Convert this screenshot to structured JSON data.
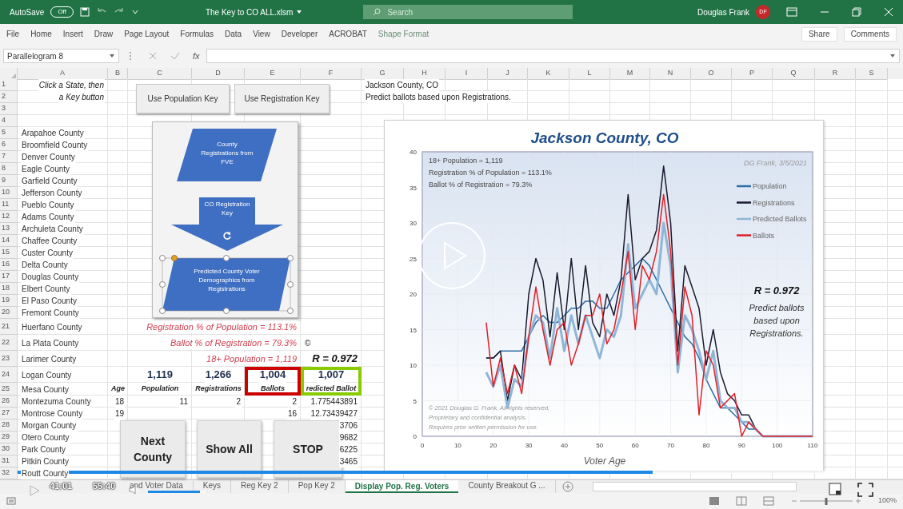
{
  "title_bar": {
    "autosave_label": "AutoSave",
    "autosave_toggle": {
      "text": "Off",
      "on": false
    },
    "file_title": "The Key to CO ALL.xlsm",
    "search_placeholder": "Search",
    "user_name": "Douglas Frank",
    "avatar_initials": "DF"
  },
  "ribbon_tabs": [
    {
      "label": "File",
      "selected": false,
      "kind": "standard"
    },
    {
      "label": "Home",
      "selected": false,
      "kind": "standard"
    },
    {
      "label": "Insert",
      "selected": false,
      "kind": "standard"
    },
    {
      "label": "Draw",
      "selected": false,
      "kind": "standard"
    },
    {
      "label": "Page Layout",
      "selected": false,
      "kind": "standard"
    },
    {
      "label": "Formulas",
      "selected": false,
      "kind": "standard"
    },
    {
      "label": "Data",
      "selected": false,
      "kind": "standard"
    },
    {
      "label": "View",
      "selected": false,
      "kind": "standard"
    },
    {
      "label": "Developer",
      "selected": false,
      "kind": "standard"
    },
    {
      "label": "ACROBAT",
      "selected": false,
      "kind": "standard"
    },
    {
      "label": "Shape Format",
      "selected": false,
      "kind": "contextual"
    }
  ],
  "ribbon_actions": [
    "Share",
    "Comments"
  ],
  "formula_bar": {
    "name_box": "Parallelogram 8",
    "fx": "fx"
  },
  "columns": [
    "A",
    "B",
    "C",
    "D",
    "E",
    "F",
    "G",
    "H",
    "I",
    "J",
    "K",
    "L",
    "M",
    "N",
    "O",
    "P",
    "Q",
    "R",
    "S"
  ],
  "rows": [
    {
      "number": "1",
      "cells": {
        "A": {
          "kind": "note",
          "text": "Click a State, then"
        },
        "G": {
          "kind": "plain",
          "text": "Jackson County, CO"
        }
      }
    },
    {
      "number": "2",
      "cells": {
        "A": {
          "kind": "note",
          "text": "a Key button"
        },
        "G": {
          "kind": "plain",
          "text": "Predict ballots based upon Registrations."
        }
      }
    },
    {
      "number": "3"
    },
    {
      "number": "4"
    },
    {
      "number": "5",
      "cells": {
        "A": {
          "kind": "county",
          "text": "Arapahoe County"
        }
      }
    },
    {
      "number": "6",
      "cells": {
        "A": {
          "kind": "county",
          "text": "Broomfield County"
        }
      }
    },
    {
      "number": "7",
      "cells": {
        "A": {
          "kind": "county",
          "text": "Denver County"
        }
      }
    },
    {
      "number": "8",
      "cells": {
        "A": {
          "kind": "county",
          "text": "Eagle County"
        }
      }
    },
    {
      "number": "9",
      "cells": {
        "A": {
          "kind": "county",
          "text": "Garfield County"
        }
      }
    },
    {
      "number": "10",
      "cells": {
        "A": {
          "kind": "county",
          "text": "Jefferson County"
        }
      }
    },
    {
      "number": "11",
      "cells": {
        "A": {
          "kind": "county",
          "text": "Pueblo County"
        }
      }
    },
    {
      "number": "12",
      "cells": {
        "A": {
          "kind": "county",
          "text": "Adams County"
        }
      }
    },
    {
      "number": "13",
      "cells": {
        "A": {
          "kind": "county",
          "text": "Archuleta County"
        }
      }
    },
    {
      "number": "14",
      "cells": {
        "A": {
          "kind": "county",
          "text": "Chaffee County"
        }
      }
    },
    {
      "number": "15",
      "cells": {
        "A": {
          "kind": "county",
          "text": "Custer County"
        }
      }
    },
    {
      "number": "16",
      "cells": {
        "A": {
          "kind": "county",
          "text": "Delta County"
        }
      }
    },
    {
      "number": "17",
      "cells": {
        "A": {
          "kind": "county",
          "text": "Douglas County"
        }
      }
    },
    {
      "number": "18",
      "cells": {
        "A": {
          "kind": "county",
          "text": "Elbert County"
        }
      }
    },
    {
      "number": "19",
      "cells": {
        "A": {
          "kind": "county",
          "text": "El Paso County"
        }
      }
    },
    {
      "number": "20",
      "cells": {
        "A": {
          "kind": "county",
          "text": "Fremont County"
        }
      }
    },
    {
      "number": "21",
      "cells": {
        "A": {
          "kind": "county",
          "text": "Huerfano County"
        },
        "C": {
          "kind": "stat",
          "text": "Registration % of Population = 113.1%"
        }
      }
    },
    {
      "number": "22",
      "cells": {
        "A": {
          "kind": "county",
          "text": "La Plata County"
        },
        "C": {
          "kind": "stat",
          "text": "Ballot % of Registration = 79.3%"
        },
        "F": {
          "kind": "plain",
          "text": "©"
        }
      }
    },
    {
      "number": "23",
      "cells": {
        "A": {
          "kind": "county",
          "text": "Larimer County"
        },
        "C": {
          "kind": "stat",
          "text": "18+ Population = 1,119"
        },
        "F": {
          "kind": "score",
          "text": "R = 0.972"
        }
      }
    },
    {
      "number": "24",
      "cells": {
        "A": {
          "kind": "county",
          "text": "Logan County"
        },
        "C": {
          "kind": "total",
          "text": "1,119"
        },
        "D": {
          "kind": "total",
          "text": "1,266"
        },
        "E": {
          "kind": "total",
          "text": "1,004",
          "color": "#cc0000"
        },
        "F": {
          "kind": "total",
          "text": "1,007",
          "color": "#88cc00"
        }
      }
    },
    {
      "number": "25",
      "cells": {
        "A": {
          "kind": "county",
          "text": "Mesa County"
        },
        "B": {
          "kind": "header",
          "text": "Age"
        },
        "C": {
          "kind": "header",
          "text": "Population"
        },
        "D": {
          "kind": "header",
          "text": "Registrations"
        },
        "E": {
          "kind": "header",
          "text": "Ballots"
        },
        "F": {
          "kind": "header",
          "text": "redicted Ballot"
        }
      }
    },
    {
      "number": "26",
      "cells": {
        "A": {
          "kind": "county",
          "text": "Montezuma County"
        },
        "B": {
          "kind": "number",
          "text": "18"
        },
        "C": {
          "kind": "number",
          "text": "11"
        },
        "D": {
          "kind": "number",
          "text": "2"
        },
        "E": {
          "kind": "number",
          "text": "2"
        },
        "F": {
          "kind": "number",
          "text": "1.775443891"
        }
      }
    },
    {
      "number": "27",
      "cells": {
        "A": {
          "kind": "county",
          "text": "Montrose County"
        },
        "B": {
          "kind": "number",
          "text": "19"
        },
        "E": {
          "kind": "number",
          "text": "16"
        },
        "F": {
          "kind": "number",
          "text": "12.73439427"
        }
      }
    },
    {
      "number": "28",
      "cells": {
        "A": {
          "kind": "county",
          "text": "Morgan County"
        },
        "F": {
          "kind": "number",
          "text": "3706"
        }
      }
    },
    {
      "number": "29",
      "cells": {
        "A": {
          "kind": "county",
          "text": "Otero County"
        },
        "F": {
          "kind": "number",
          "text": "9682"
        }
      }
    },
    {
      "number": "30",
      "cells": {
        "A": {
          "kind": "county",
          "text": "Park County"
        },
        "F": {
          "kind": "number",
          "text": "6225"
        }
      }
    },
    {
      "number": "31",
      "cells": {
        "A": {
          "kind": "county",
          "text": "Pitkin County"
        },
        "F": {
          "kind": "number",
          "text": "3465"
        }
      }
    },
    {
      "number": "32",
      "cells": {
        "A": {
          "kind": "county",
          "text": "Routt County"
        }
      }
    }
  ],
  "key_buttons": [
    "Use Population Key",
    "Use Registration Key"
  ],
  "flowchart": {
    "source": "County Registrations from FVE",
    "key": "CO Registration Key",
    "result": "Predicted County Voter Demographics from Registrations"
  },
  "action_buttons": [
    "Next County",
    "Show All",
    "STOP"
  ],
  "chart": {
    "stats_lines": [
      "18+ Population = 1,119",
      "Registration % of Population = 113.1%",
      "Ballot % of Registration = 79.3%"
    ],
    "signature": "DG Frank, 3/5/2021",
    "result": "R = 0.972",
    "note": "Predict ballots based upon Registrations.",
    "copyright": [
      "© 2021 Douglas G. Frank, All rights reserved.",
      "Proprietary and confidential analysis.",
      "Requires prior written permission for use."
    ],
    "chart_data": {
      "type": "line",
      "title": "Jackson County, CO",
      "xlabel": "Voter Age",
      "grid": true,
      "legend": true,
      "x": [
        18,
        20,
        22,
        24,
        26,
        28,
        30,
        32,
        34,
        36,
        38,
        40,
        42,
        44,
        46,
        48,
        50,
        52,
        54,
        56,
        58,
        60,
        62,
        64,
        66,
        68,
        70,
        72,
        74,
        76,
        78,
        80,
        82,
        84,
        86,
        88,
        90,
        92,
        94,
        96,
        110
      ],
      "series": [
        {
          "name": "Population",
          "color": "#2e6da4",
          "values": [
            11,
            11,
            12,
            12,
            12,
            12,
            14,
            16,
            17,
            16,
            16,
            17,
            18,
            18,
            19,
            19,
            18,
            18,
            20,
            22,
            23,
            24,
            25,
            24,
            22,
            20,
            18,
            16,
            14,
            13,
            11,
            8,
            6,
            4,
            4,
            3,
            2,
            1,
            1,
            0,
            0
          ]
        },
        {
          "name": "Registrations",
          "color": "#1a1a2e",
          "values": [
            11,
            11,
            12,
            5,
            10,
            8,
            20,
            25,
            22,
            14,
            23,
            15,
            25,
            15,
            24,
            16,
            14,
            20,
            17,
            22,
            34,
            22,
            25,
            26,
            29,
            38,
            30,
            12,
            24,
            21,
            18,
            10,
            15,
            9,
            6,
            5,
            3,
            3,
            1,
            0,
            0
          ]
        },
        {
          "name": "Predicted Ballots",
          "color": "#8fb6d6",
          "values": [
            9,
            7,
            10,
            4,
            8,
            7,
            14,
            17,
            16,
            11,
            18,
            12,
            17,
            13,
            17,
            14,
            11,
            15,
            14,
            17,
            27,
            18,
            20,
            22,
            20,
            30,
            24,
            9,
            17,
            15,
            12,
            8,
            12,
            5,
            4,
            4,
            2,
            2,
            1,
            0,
            0
          ]
        },
        {
          "name": "Ballots",
          "color": "#e0202a",
          "values": [
            16,
            7,
            11,
            6,
            10,
            6,
            14,
            21,
            15,
            10,
            15,
            16,
            10,
            13,
            17,
            17,
            20,
            13,
            15,
            20,
            26,
            15,
            24,
            22,
            26,
            34,
            26,
            10,
            21,
            17,
            3,
            12,
            10,
            4,
            5,
            6,
            0,
            2,
            1,
            0,
            0
          ]
        }
      ],
      "xlim": [
        0,
        110
      ],
      "ylim": [
        0,
        40
      ],
      "xticks": [
        0,
        10,
        20,
        30,
        40,
        50,
        60,
        70,
        80,
        90,
        100,
        110
      ],
      "yticks": [
        0,
        5,
        10,
        15,
        20,
        25,
        30,
        35,
        40
      ]
    }
  },
  "video": {
    "elapsed": "41:01",
    "duration": "55:40",
    "progress": {
      "level": 0.78
    },
    "volume": {
      "level": 0.9
    }
  },
  "sheet_tabs": [
    {
      "label": "and Voter Data",
      "selected": false
    },
    {
      "label": "Keys",
      "selected": false
    },
    {
      "label": "Reg Key 2",
      "selected": false
    },
    {
      "label": "Pop Key 2",
      "selected": false
    },
    {
      "label": "Display Pop. Reg. Voters",
      "selected": true
    },
    {
      "label": "County Breakout G ...",
      "selected": false
    }
  ],
  "status_bar": {
    "zoom": "100%",
    "zoom_slider": {
      "level": 0.5
    }
  }
}
